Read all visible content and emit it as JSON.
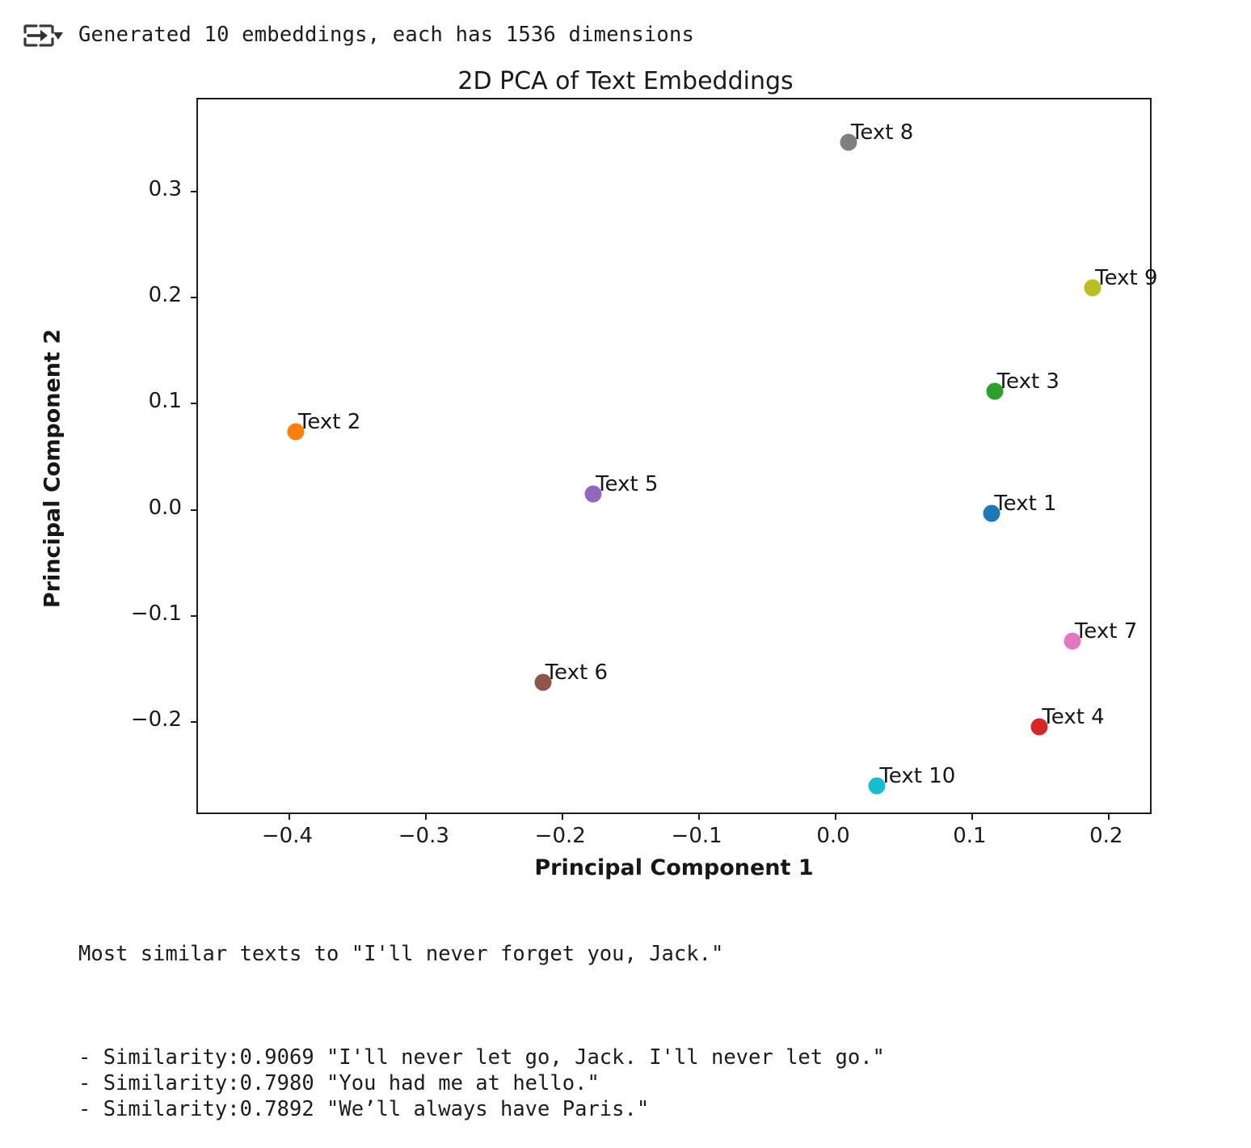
{
  "output": {
    "icon": "stream-output-icon",
    "text": "Generated 10 embeddings, each has 1536 dimensions"
  },
  "chart_data": {
    "type": "scatter",
    "title": "2D PCA of Text Embeddings",
    "xlabel": "Principal Component 1",
    "ylabel": "Principal Component 2",
    "xlim": [
      -0.4666,
      0.2333
    ],
    "ylim": [
      -0.2888,
      0.3857
    ],
    "xticks": [
      "−0.4",
      "−0.3",
      "−0.2",
      "−0.1",
      "0.0",
      "0.1",
      "0.2"
    ],
    "xtick_values": [
      -0.4,
      -0.3,
      -0.2,
      -0.1,
      0.0,
      0.1,
      0.2
    ],
    "yticks": [
      "0.3",
      "0.2",
      "0.1",
      "0.0",
      "−0.1",
      "−0.2"
    ],
    "ytick_values": [
      0.3,
      0.2,
      0.1,
      0.0,
      -0.1,
      -0.2
    ],
    "grid": false,
    "legend": "none",
    "points": [
      {
        "label": "Text 1",
        "x": 0.115,
        "y": -0.004,
        "color": "#1f77b4"
      },
      {
        "label": "Text 2",
        "x": -0.395,
        "y": 0.073,
        "color": "#ff7f0e"
      },
      {
        "label": "Text 3",
        "x": 0.117,
        "y": 0.111,
        "color": "#2ca02c"
      },
      {
        "label": "Text 4",
        "x": 0.15,
        "y": -0.205,
        "color": "#d62728"
      },
      {
        "label": "Text 5",
        "x": -0.177,
        "y": 0.014,
        "color": "#9467bd"
      },
      {
        "label": "Text 6",
        "x": -0.214,
        "y": -0.163,
        "color": "#8c564b"
      },
      {
        "label": "Text 7",
        "x": 0.174,
        "y": -0.124,
        "color": "#e377c2"
      },
      {
        "label": "Text 8",
        "x": 0.01,
        "y": 0.345,
        "color": "#7f7f7f"
      },
      {
        "label": "Text 9",
        "x": 0.189,
        "y": 0.208,
        "color": "#bcbd22"
      },
      {
        "label": "Text 10",
        "x": 0.031,
        "y": -0.261,
        "color": "#17becf"
      }
    ]
  },
  "similarity_output": {
    "heading": "Most similar texts to \"I'll never forget you, Jack.\"",
    "results": [
      "- Similarity:0.9069 \"I'll never let go, Jack. I'll never let go.\"",
      "- Similarity:0.7980 \"You had me at hello.\"",
      "- Similarity:0.7892 \"We’ll always have Paris.\""
    ]
  }
}
